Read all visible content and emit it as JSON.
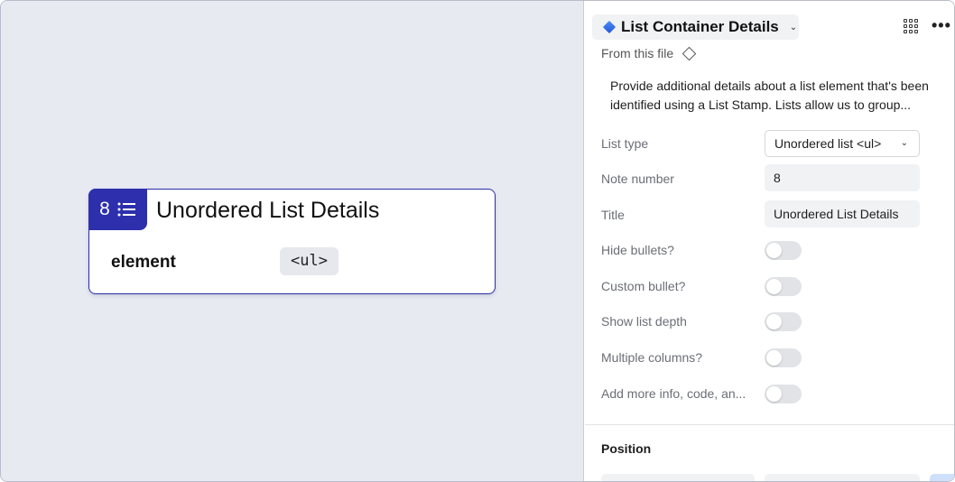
{
  "canvas": {
    "card": {
      "number": "8",
      "title": "Unordered List Details",
      "element_label": "element",
      "element_value": "<ul>",
      "accent_color": "#2d2fad"
    }
  },
  "panel": {
    "component_name": "List Container Details",
    "component_chevron": "⌄",
    "from_file": "From this file",
    "description": [
      "Provide additional details about a list element that's been",
      "identified using a List Stamp. Lists allow us to group..."
    ],
    "props": {
      "list_type": {
        "label": "List type",
        "value": "Unordered list <ul>"
      },
      "note_number": {
        "label": "Note number",
        "value": "8"
      },
      "title": {
        "label": "Title",
        "value": "Unordered List Details"
      },
      "hide_bullets": {
        "label": "Hide bullets?"
      },
      "custom_bullet": {
        "label": "Custom bullet?"
      },
      "show_list_depth": {
        "label": "Show list depth"
      },
      "multiple_columns": {
        "label": "Multiple columns?"
      },
      "add_more_info": {
        "label": "Add more info, code, an..."
      }
    },
    "position_section": "Position"
  },
  "icons": {
    "component": "component-diamond-icon",
    "grid": "grid-icon",
    "more": "more-icon",
    "list": "list-icon",
    "from_file": "outline-diamond-icon"
  }
}
